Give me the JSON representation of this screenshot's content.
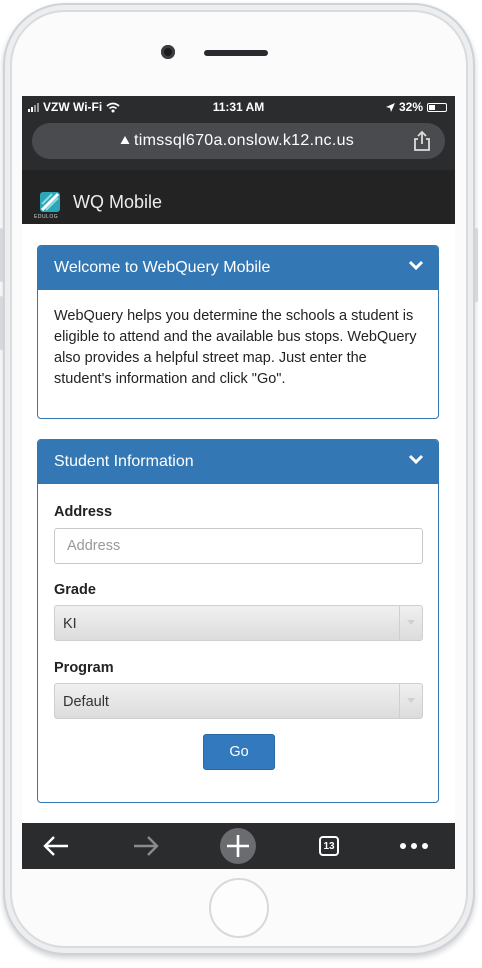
{
  "status_bar": {
    "carrier": "VZW Wi-Fi",
    "time": "11:31 AM",
    "battery": "32%"
  },
  "browser": {
    "url": "timssql670a.onslow.k12.nc.us",
    "tab_count": "13"
  },
  "app": {
    "title": "WQ Mobile",
    "logo_caption": "EDULOG"
  },
  "welcome_panel": {
    "title": "Welcome to WebQuery Mobile",
    "body": "WebQuery helps you determine the schools a student is eligible to attend and the available bus stops. WebQuery also provides a helpful street map. Just enter the student's information and click \"Go\"."
  },
  "student_panel": {
    "title": "Student Information",
    "address_label": "Address",
    "address_placeholder": "Address",
    "address_value": "",
    "grade_label": "Grade",
    "grade_value": "KI",
    "program_label": "Program",
    "program_value": "Default",
    "go_label": "Go"
  },
  "colors": {
    "accent": "#3477b5",
    "button": "#3279bd",
    "chrome": "#2b2c2e"
  },
  "icons": {
    "back": "arrow-left-icon",
    "forward": "arrow-right-icon",
    "new_tab": "plus-circle-icon",
    "more": "ellipsis-icon",
    "share": "share-icon",
    "secure": "lock-triangle-icon",
    "collapse": "chevron-down-icon"
  }
}
